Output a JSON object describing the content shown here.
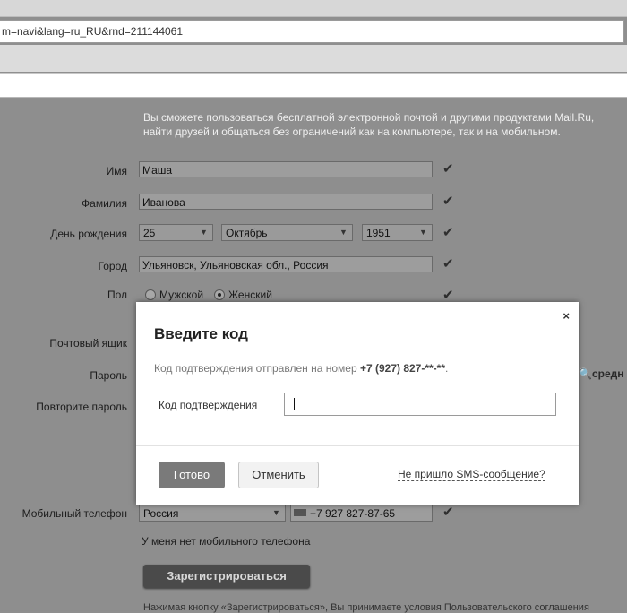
{
  "browser": {
    "url": "m=navi&lang=ru_RU&rnd=211144061"
  },
  "form": {
    "intro_line1": "Вы сможете пользоваться бесплатной электронной почтой и другими продуктами Mail.Ru,",
    "intro_line2": "найти друзей и общаться без ограничений как на компьютере, так и на мобильном.",
    "name_label": "Имя",
    "name_value": "Маша",
    "surname_label": "Фамилия",
    "surname_value": "Иванова",
    "birthday_label": "День рождения",
    "birthday_day": "25",
    "birthday_month": "Октябрь",
    "birthday_year": "1951",
    "city_label": "Город",
    "city_value": "Ульяновск, Ульяновская обл., Россия",
    "gender_label": "Пол",
    "gender_male": "Мужской",
    "gender_female": "Женский",
    "mailbox_label": "Почтовый ящик",
    "password_label": "Пароль",
    "password_strength": "средн",
    "password_repeat_label": "Повторите пароль",
    "phone_label": "Мобильный телефон",
    "phone_country": "Россия",
    "phone_value": "+7 927 827-87-65",
    "no_phone_link": "У меня нет мобильного телефона",
    "register_button": "Зарегистрироваться",
    "footer_text": "Нажимая кнопку «Зарегистрироваться», Вы принимаете условия Пользовательского соглашения"
  },
  "modal": {
    "title": "Введите код",
    "close": "×",
    "info_text": "Код подтверждения отправлен на номер ",
    "info_number": "+7 (927) 827-**-**",
    "info_end": ".",
    "code_label": "Код подтверждения",
    "code_value": "",
    "ok_button": "Готово",
    "cancel_button": "Отменить",
    "no_sms_link": "Не пришло SMS-сообщение?"
  },
  "icons": {
    "check": "check-icon",
    "dropdown": "chevron-down-icon"
  }
}
